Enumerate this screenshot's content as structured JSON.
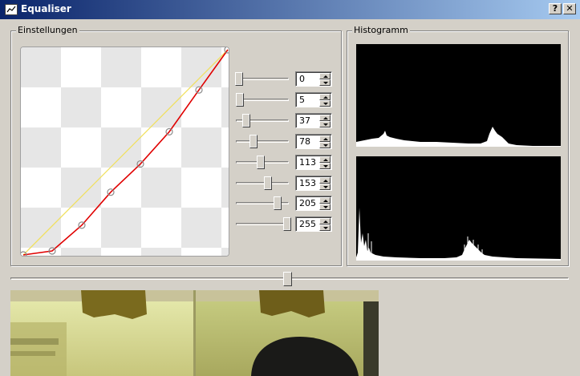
{
  "window": {
    "title": "Equaliser",
    "help_label": "?",
    "close_label": "✕"
  },
  "settings": {
    "label": "Einstellungen",
    "curve_points": [
      {
        "input": 0,
        "output": 0
      },
      {
        "input": 36,
        "output": 5
      },
      {
        "input": 73,
        "output": 37
      },
      {
        "input": 109,
        "output": 78
      },
      {
        "input": 146,
        "output": 113
      },
      {
        "input": 182,
        "output": 153
      },
      {
        "input": 219,
        "output": 205
      },
      {
        "input": 255,
        "output": 255
      }
    ],
    "sliders": [
      {
        "value": "0"
      },
      {
        "value": "5"
      },
      {
        "value": "37"
      },
      {
        "value": "78"
      },
      {
        "value": "113"
      },
      {
        "value": "153"
      },
      {
        "value": "205"
      },
      {
        "value": "255"
      }
    ]
  },
  "histogram": {
    "label": "Histogramm"
  },
  "colors": {
    "curve": "#e00000",
    "identity_line": "#f0e060",
    "title_gradient_start": "#0a246a",
    "title_gradient_end": "#a6caf0"
  }
}
